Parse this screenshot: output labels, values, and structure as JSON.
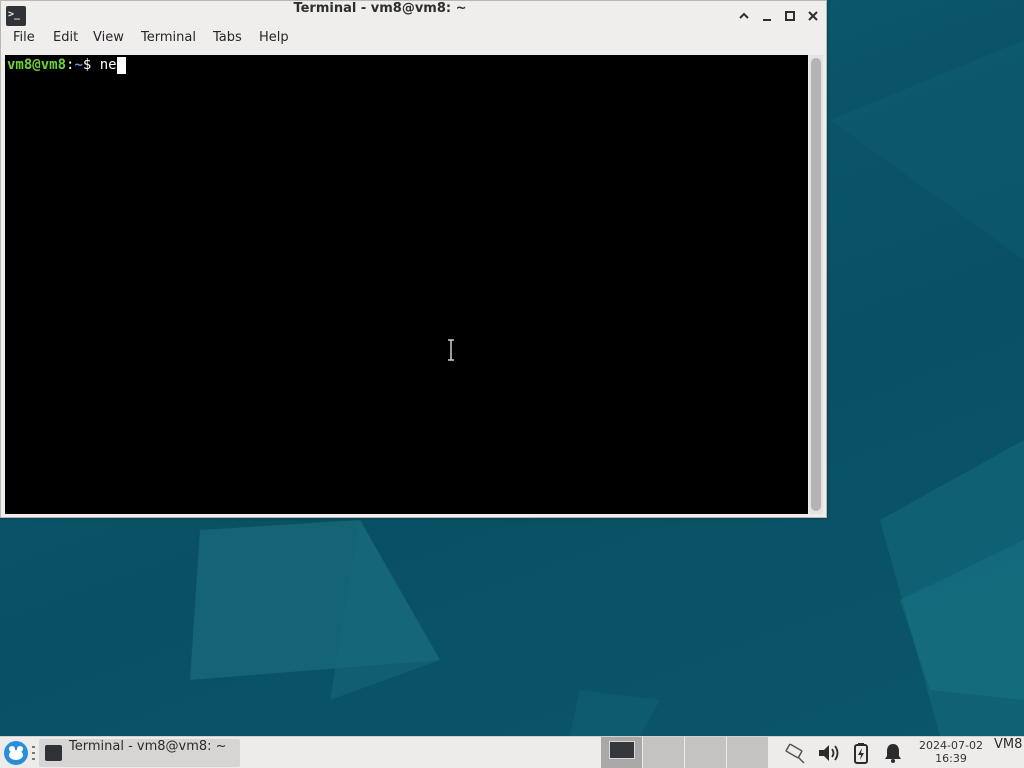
{
  "window": {
    "title": "Terminal - vm8@vm8: ~",
    "app_icon_glyph": ">_"
  },
  "menu": {
    "file": "File",
    "edit": "Edit",
    "view": "View",
    "terminal": "Terminal",
    "tabs": "Tabs",
    "help": "Help"
  },
  "terminal": {
    "user_host": "vm8@vm8",
    "colon": ":",
    "path": "~",
    "prompt_symbol": "$ ",
    "typed_command": "ne"
  },
  "taskbar": {
    "task_label": "Terminal - vm8@vm8: ~",
    "clock_date": "2024-07-02",
    "clock_time": "16:39",
    "hostname": "VM8"
  },
  "icons": {
    "app": "terminal-icon",
    "shade": "chevron-up-icon",
    "minimize": "minimize-icon",
    "maximize": "maximize-icon",
    "close": "close-icon",
    "whisker": "whisker-menu-icon",
    "network": "network-icon",
    "volume": "volume-icon",
    "battery": "battery-charging-icon",
    "notifications": "bell-icon"
  },
  "colors": {
    "prompt_user": "#6fd13a",
    "prompt_path": "#7a8ad8",
    "terminal_bg": "#000000",
    "desktop_bg": "#0b566a"
  }
}
